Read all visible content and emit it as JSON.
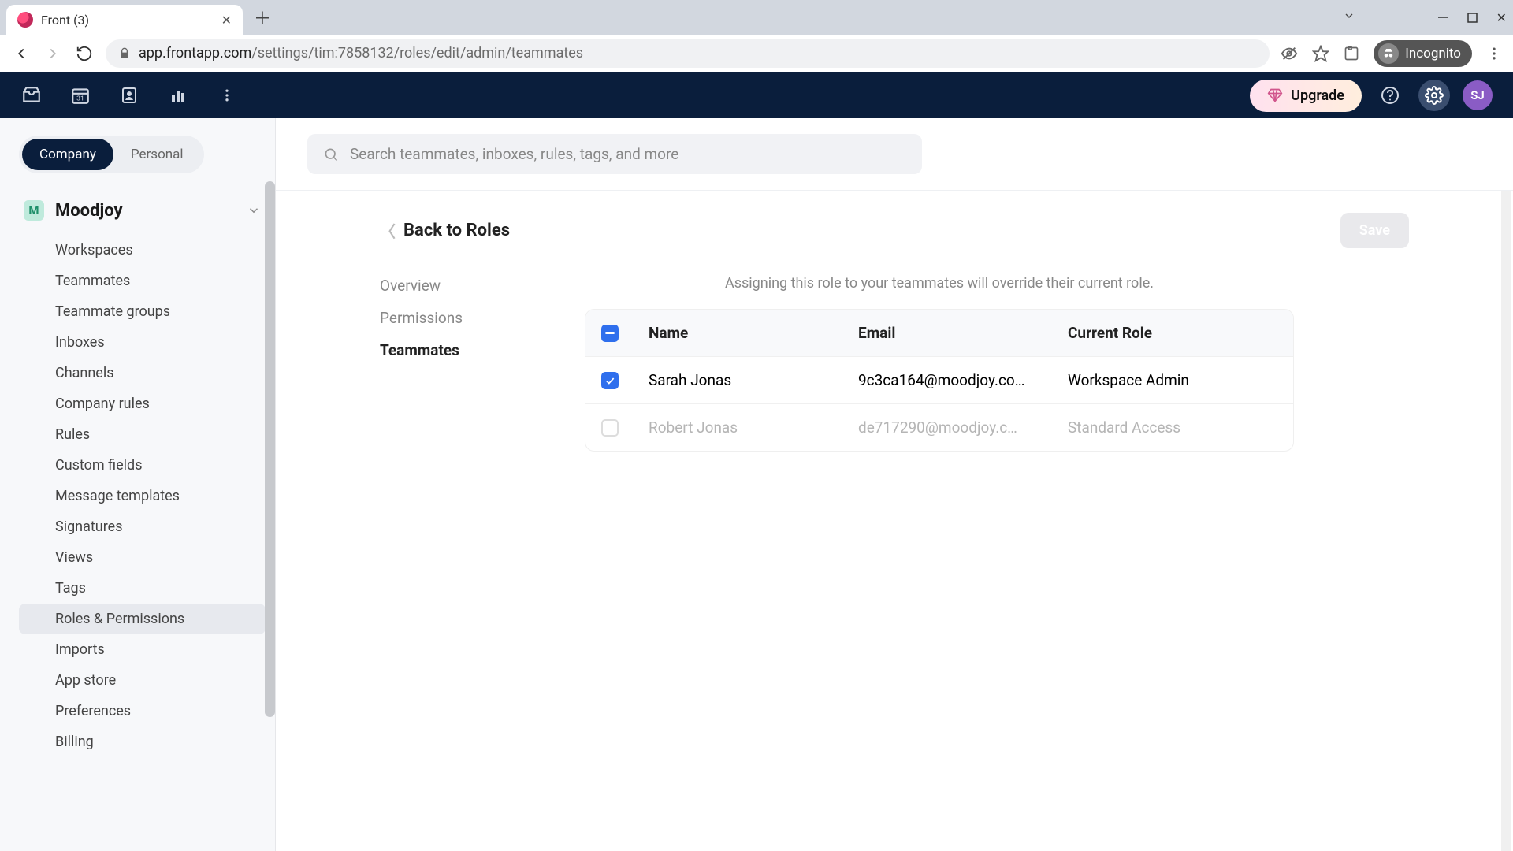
{
  "browser": {
    "tab_title": "Front (3)",
    "url_domain": "app.frontapp.com",
    "url_path": "/settings/tim:7858132/roles/edit/admin/teammates",
    "incognito_label": "Incognito"
  },
  "header": {
    "upgrade_label": "Upgrade",
    "avatar_initials": "SJ"
  },
  "sidebar": {
    "scope": {
      "company": "Company",
      "personal": "Personal"
    },
    "workspace_initial": "M",
    "workspace_name": "Moodjoy",
    "items": [
      {
        "label": "Workspaces"
      },
      {
        "label": "Teammates"
      },
      {
        "label": "Teammate groups"
      },
      {
        "label": "Inboxes"
      },
      {
        "label": "Channels"
      },
      {
        "label": "Company rules"
      },
      {
        "label": "Rules"
      },
      {
        "label": "Custom fields"
      },
      {
        "label": "Message templates"
      },
      {
        "label": "Signatures"
      },
      {
        "label": "Views"
      },
      {
        "label": "Tags"
      },
      {
        "label": "Roles & Permissions"
      },
      {
        "label": "Imports"
      },
      {
        "label": "App store"
      },
      {
        "label": "Preferences"
      },
      {
        "label": "Billing"
      }
    ]
  },
  "search": {
    "placeholder": "Search teammates, inboxes, rules, tags, and more"
  },
  "page": {
    "back_label": "Back to Roles",
    "save_label": "Save",
    "subtabs": {
      "overview": "Overview",
      "permissions": "Permissions",
      "teammates": "Teammates"
    },
    "info": "Assigning this role to your teammates will override their current role.",
    "columns": {
      "name": "Name",
      "email": "Email",
      "role": "Current Role"
    },
    "rows": [
      {
        "name": "Sarah Jonas",
        "email": "9c3ca164@moodjoy.co…",
        "role": "Workspace Admin"
      },
      {
        "name": "Robert Jonas",
        "email": "de717290@moodjoy.c…",
        "role": "Standard Access"
      }
    ]
  }
}
